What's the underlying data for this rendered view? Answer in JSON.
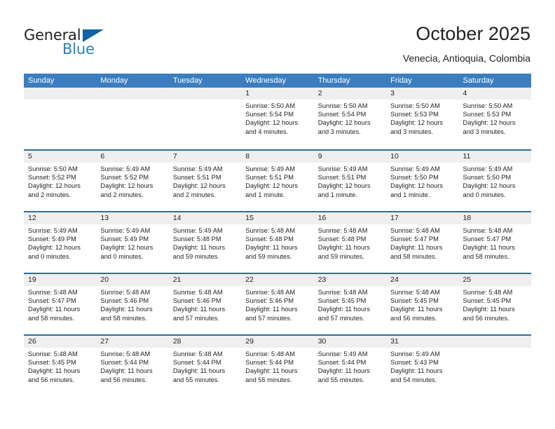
{
  "brand": {
    "name_dark": "General",
    "name_blue": "Blue",
    "accent_color": "#2980c4",
    "triangle_color": "#0b63a8"
  },
  "header": {
    "title": "October 2025",
    "subtitle": "Venecia, Antioquia, Colombia"
  },
  "calendar": {
    "header_bg": "#3a7ebf",
    "row_divider_color": "#2f6ca8",
    "day_band_bg": "#efefef",
    "day_names": [
      "Sunday",
      "Monday",
      "Tuesday",
      "Wednesday",
      "Thursday",
      "Friday",
      "Saturday"
    ],
    "weeks": [
      [
        {
          "day": "",
          "sunrise": "",
          "sunset": "",
          "daylight_line1": "",
          "daylight_line2": "",
          "empty": true
        },
        {
          "day": "",
          "sunrise": "",
          "sunset": "",
          "daylight_line1": "",
          "daylight_line2": "",
          "empty": true
        },
        {
          "day": "",
          "sunrise": "",
          "sunset": "",
          "daylight_line1": "",
          "daylight_line2": "",
          "empty": true
        },
        {
          "day": "1",
          "sunrise": "Sunrise: 5:50 AM",
          "sunset": "Sunset: 5:54 PM",
          "daylight_line1": "Daylight: 12 hours",
          "daylight_line2": "and 4 minutes."
        },
        {
          "day": "2",
          "sunrise": "Sunrise: 5:50 AM",
          "sunset": "Sunset: 5:54 PM",
          "daylight_line1": "Daylight: 12 hours",
          "daylight_line2": "and 3 minutes."
        },
        {
          "day": "3",
          "sunrise": "Sunrise: 5:50 AM",
          "sunset": "Sunset: 5:53 PM",
          "daylight_line1": "Daylight: 12 hours",
          "daylight_line2": "and 3 minutes."
        },
        {
          "day": "4",
          "sunrise": "Sunrise: 5:50 AM",
          "sunset": "Sunset: 5:53 PM",
          "daylight_line1": "Daylight: 12 hours",
          "daylight_line2": "and 3 minutes."
        }
      ],
      [
        {
          "day": "5",
          "sunrise": "Sunrise: 5:50 AM",
          "sunset": "Sunset: 5:52 PM",
          "daylight_line1": "Daylight: 12 hours",
          "daylight_line2": "and 2 minutes."
        },
        {
          "day": "6",
          "sunrise": "Sunrise: 5:49 AM",
          "sunset": "Sunset: 5:52 PM",
          "daylight_line1": "Daylight: 12 hours",
          "daylight_line2": "and 2 minutes."
        },
        {
          "day": "7",
          "sunrise": "Sunrise: 5:49 AM",
          "sunset": "Sunset: 5:51 PM",
          "daylight_line1": "Daylight: 12 hours",
          "daylight_line2": "and 2 minutes."
        },
        {
          "day": "8",
          "sunrise": "Sunrise: 5:49 AM",
          "sunset": "Sunset: 5:51 PM",
          "daylight_line1": "Daylight: 12 hours",
          "daylight_line2": "and 1 minute."
        },
        {
          "day": "9",
          "sunrise": "Sunrise: 5:49 AM",
          "sunset": "Sunset: 5:51 PM",
          "daylight_line1": "Daylight: 12 hours",
          "daylight_line2": "and 1 minute."
        },
        {
          "day": "10",
          "sunrise": "Sunrise: 5:49 AM",
          "sunset": "Sunset: 5:50 PM",
          "daylight_line1": "Daylight: 12 hours",
          "daylight_line2": "and 1 minute."
        },
        {
          "day": "11",
          "sunrise": "Sunrise: 5:49 AM",
          "sunset": "Sunset: 5:50 PM",
          "daylight_line1": "Daylight: 12 hours",
          "daylight_line2": "and 0 minutes."
        }
      ],
      [
        {
          "day": "12",
          "sunrise": "Sunrise: 5:49 AM",
          "sunset": "Sunset: 5:49 PM",
          "daylight_line1": "Daylight: 12 hours",
          "daylight_line2": "and 0 minutes."
        },
        {
          "day": "13",
          "sunrise": "Sunrise: 5:49 AM",
          "sunset": "Sunset: 5:49 PM",
          "daylight_line1": "Daylight: 12 hours",
          "daylight_line2": "and 0 minutes."
        },
        {
          "day": "14",
          "sunrise": "Sunrise: 5:49 AM",
          "sunset": "Sunset: 5:48 PM",
          "daylight_line1": "Daylight: 11 hours",
          "daylight_line2": "and 59 minutes."
        },
        {
          "day": "15",
          "sunrise": "Sunrise: 5:48 AM",
          "sunset": "Sunset: 5:48 PM",
          "daylight_line1": "Daylight: 11 hours",
          "daylight_line2": "and 59 minutes."
        },
        {
          "day": "16",
          "sunrise": "Sunrise: 5:48 AM",
          "sunset": "Sunset: 5:48 PM",
          "daylight_line1": "Daylight: 11 hours",
          "daylight_line2": "and 59 minutes."
        },
        {
          "day": "17",
          "sunrise": "Sunrise: 5:48 AM",
          "sunset": "Sunset: 5:47 PM",
          "daylight_line1": "Daylight: 11 hours",
          "daylight_line2": "and 58 minutes."
        },
        {
          "day": "18",
          "sunrise": "Sunrise: 5:48 AM",
          "sunset": "Sunset: 5:47 PM",
          "daylight_line1": "Daylight: 11 hours",
          "daylight_line2": "and 58 minutes."
        }
      ],
      [
        {
          "day": "19",
          "sunrise": "Sunrise: 5:48 AM",
          "sunset": "Sunset: 5:47 PM",
          "daylight_line1": "Daylight: 11 hours",
          "daylight_line2": "and 58 minutes."
        },
        {
          "day": "20",
          "sunrise": "Sunrise: 5:48 AM",
          "sunset": "Sunset: 5:46 PM",
          "daylight_line1": "Daylight: 11 hours",
          "daylight_line2": "and 58 minutes."
        },
        {
          "day": "21",
          "sunrise": "Sunrise: 5:48 AM",
          "sunset": "Sunset: 5:46 PM",
          "daylight_line1": "Daylight: 11 hours",
          "daylight_line2": "and 57 minutes."
        },
        {
          "day": "22",
          "sunrise": "Sunrise: 5:48 AM",
          "sunset": "Sunset: 5:46 PM",
          "daylight_line1": "Daylight: 11 hours",
          "daylight_line2": "and 57 minutes."
        },
        {
          "day": "23",
          "sunrise": "Sunrise: 5:48 AM",
          "sunset": "Sunset: 5:45 PM",
          "daylight_line1": "Daylight: 11 hours",
          "daylight_line2": "and 57 minutes."
        },
        {
          "day": "24",
          "sunrise": "Sunrise: 5:48 AM",
          "sunset": "Sunset: 5:45 PM",
          "daylight_line1": "Daylight: 11 hours",
          "daylight_line2": "and 56 minutes."
        },
        {
          "day": "25",
          "sunrise": "Sunrise: 5:48 AM",
          "sunset": "Sunset: 5:45 PM",
          "daylight_line1": "Daylight: 11 hours",
          "daylight_line2": "and 56 minutes."
        }
      ],
      [
        {
          "day": "26",
          "sunrise": "Sunrise: 5:48 AM",
          "sunset": "Sunset: 5:45 PM",
          "daylight_line1": "Daylight: 11 hours",
          "daylight_line2": "and 56 minutes."
        },
        {
          "day": "27",
          "sunrise": "Sunrise: 5:48 AM",
          "sunset": "Sunset: 5:44 PM",
          "daylight_line1": "Daylight: 11 hours",
          "daylight_line2": "and 56 minutes."
        },
        {
          "day": "28",
          "sunrise": "Sunrise: 5:48 AM",
          "sunset": "Sunset: 5:44 PM",
          "daylight_line1": "Daylight: 11 hours",
          "daylight_line2": "and 55 minutes."
        },
        {
          "day": "29",
          "sunrise": "Sunrise: 5:48 AM",
          "sunset": "Sunset: 5:44 PM",
          "daylight_line1": "Daylight: 11 hours",
          "daylight_line2": "and 55 minutes."
        },
        {
          "day": "30",
          "sunrise": "Sunrise: 5:49 AM",
          "sunset": "Sunset: 5:44 PM",
          "daylight_line1": "Daylight: 11 hours",
          "daylight_line2": "and 55 minutes."
        },
        {
          "day": "31",
          "sunrise": "Sunrise: 5:49 AM",
          "sunset": "Sunset: 5:43 PM",
          "daylight_line1": "Daylight: 11 hours",
          "daylight_line2": "and 54 minutes."
        },
        {
          "day": "",
          "sunrise": "",
          "sunset": "",
          "daylight_line1": "",
          "daylight_line2": "",
          "empty": true
        }
      ]
    ]
  }
}
